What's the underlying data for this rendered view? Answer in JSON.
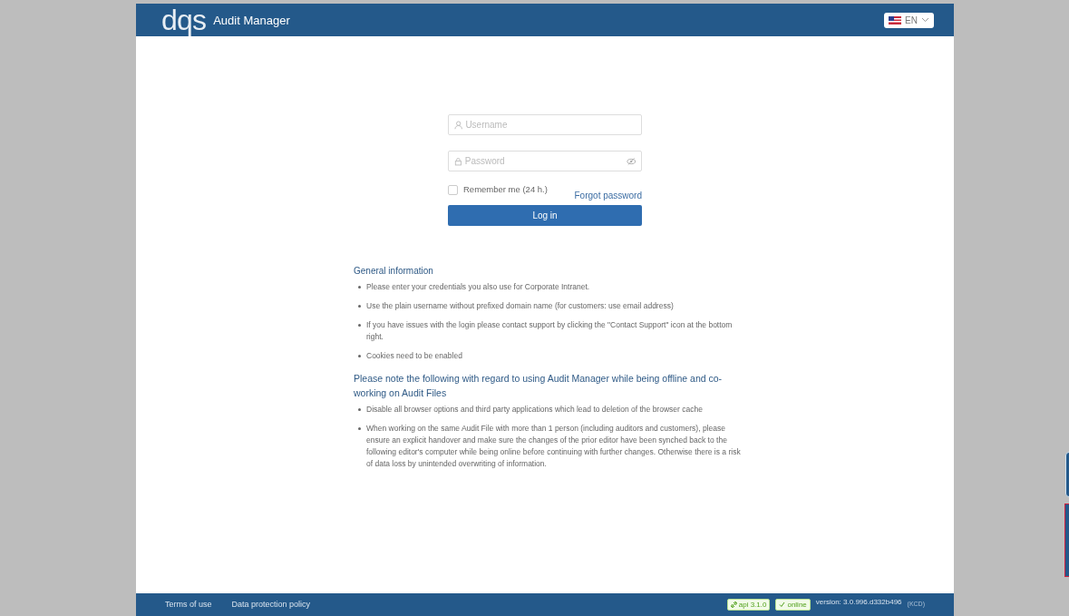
{
  "header": {
    "logo": "dqs",
    "title": "Audit Manager",
    "language": "EN"
  },
  "login": {
    "username": {
      "placeholder": "Username"
    },
    "password": {
      "placeholder": "Password"
    },
    "remember": {
      "label": "Remember me (24 h.)",
      "checked": false
    },
    "forgot": "Forgot password",
    "submit": "Log in"
  },
  "sections": [
    {
      "heading": "General information",
      "items": [
        "Please enter your credentials you also use for Corporate Intranet.",
        "Use the plain username without prefixed domain name (for customers: use email address)",
        "If you have issues with the login please contact support by clicking the \"Contact Support\" icon at the bottom right.",
        "Cookies need to be enabled"
      ]
    },
    {
      "heading": "Please note the following with regard to using Audit Manager while being offline and co-working on Audit Files",
      "items": [
        "Disable all browser options and third party applications which lead to deletion of the browser cache",
        "When working on the same Audit File with more than 1 person (including auditors and customers), please ensure an explicit handover and make sure the changes of the prior editor have been synched back to the following editor's computer while being online before continuing with further changes. Otherwise there is a risk of data loss by unintended overwriting of information."
      ]
    }
  ],
  "footer": {
    "links": [
      "Terms of use",
      "Data protection policy"
    ],
    "api_badge": "api 3.1.0",
    "status_badge": "online",
    "version": "version: 3.0.996.d332b496",
    "suffix": "(KCD)"
  }
}
